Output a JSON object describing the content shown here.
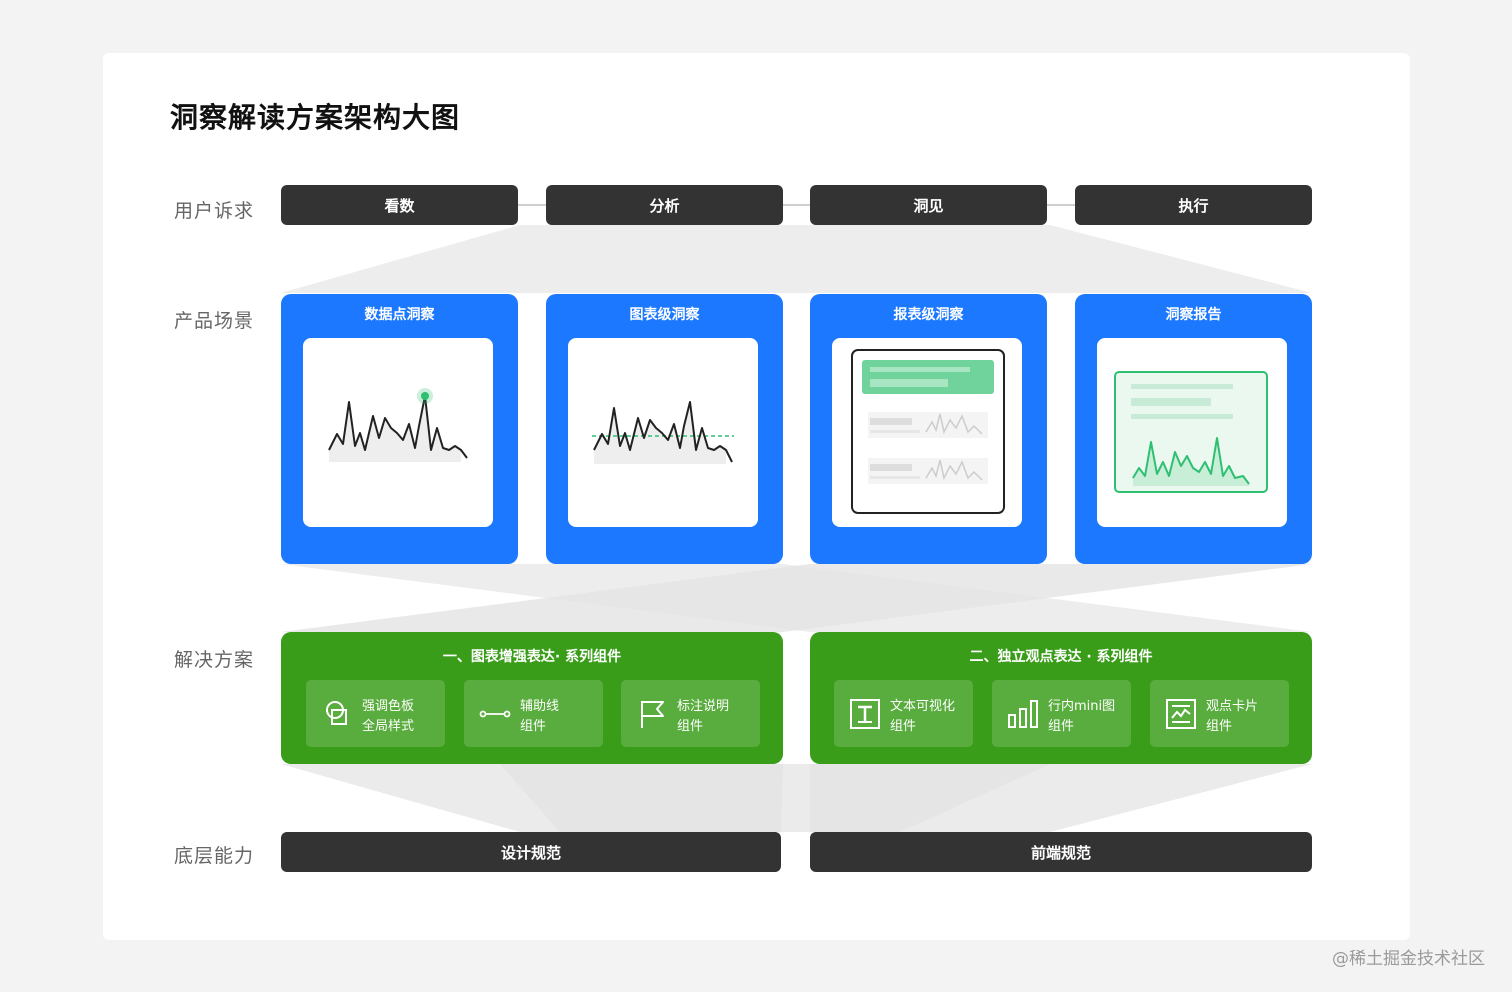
{
  "title": "洞察解读方案架构大图",
  "rows": {
    "user_needs": "用户诉求",
    "product_scenes": "产品场景",
    "solutions": "解决方案",
    "foundation": "底层能力"
  },
  "user_needs": [
    "看数",
    "分析",
    "洞见",
    "执行"
  ],
  "scenes": [
    "数据点洞察",
    "图表级洞察",
    "报表级洞察",
    "洞察报告"
  ],
  "solutions": [
    {
      "title": "一、图表增强表达· 系列组件",
      "components": [
        {
          "icon": "palette-shapes-icon",
          "line1": "强调色板",
          "line2": "全局样式"
        },
        {
          "icon": "auxiliary-line-icon",
          "line1": "辅助线",
          "line2": "组件"
        },
        {
          "icon": "flag-icon",
          "line1": "标注说明",
          "line2": "组件"
        }
      ]
    },
    {
      "title": "二、独立观点表达 · 系列组件",
      "components": [
        {
          "icon": "text-icon",
          "line1": "文本可视化",
          "line2": "组件"
        },
        {
          "icon": "bar-chart-icon",
          "line1": "行内mini图",
          "line2": "组件"
        },
        {
          "icon": "card-icon",
          "line1": "观点卡片",
          "line2": "组件"
        }
      ]
    }
  ],
  "foundation": [
    "设计规范",
    "前端规范"
  ],
  "watermark": "@稀土掘金技术社区",
  "colors": {
    "accent_blue": "#1b78ff",
    "accent_green": "#3a9d1a",
    "dark_pill": "#333333",
    "highlight_green": "#2fbf71"
  }
}
